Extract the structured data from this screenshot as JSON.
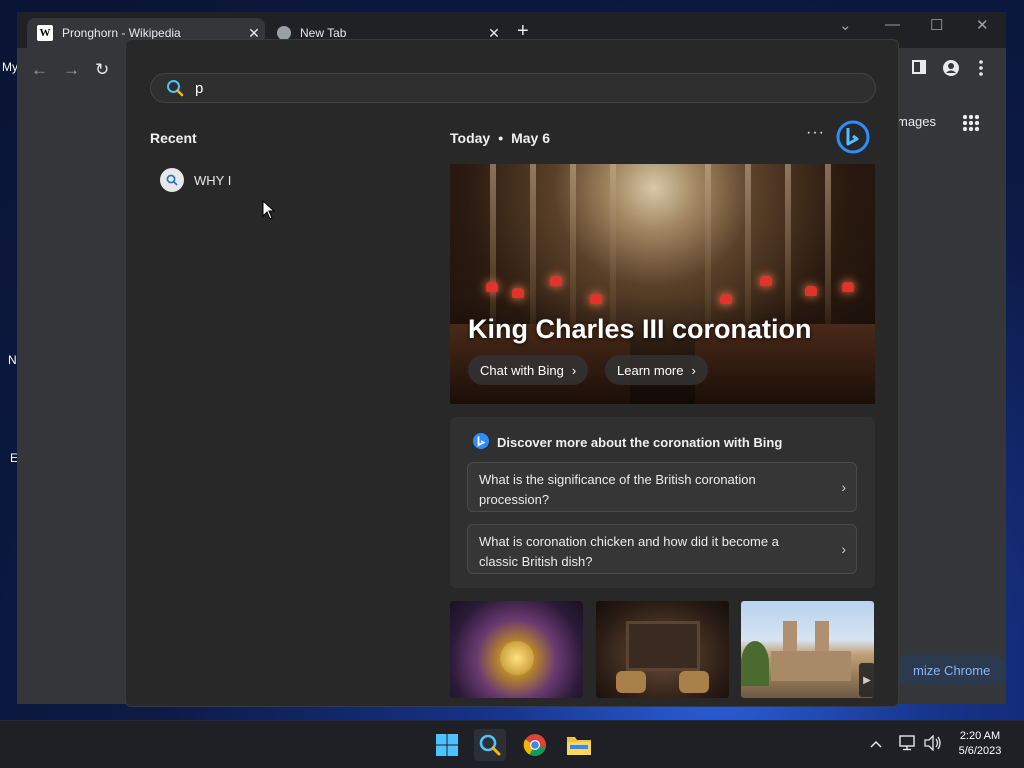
{
  "desktop": {
    "icon_labels": [
      "My",
      "N",
      "E"
    ]
  },
  "browser": {
    "tabs": [
      {
        "title": "Pronghorn - Wikipedia",
        "favicon": "W"
      },
      {
        "title": "New Tab",
        "favicon": ""
      }
    ],
    "new_tab_symbol": "+",
    "close_symbol": "✕",
    "window_controls": {
      "dropdown": "⌄",
      "minimize": "—",
      "maximize": "☐",
      "close": "✕"
    },
    "nav": {
      "back": "←",
      "forward": "→",
      "reload": "↻"
    },
    "ntp": {
      "images_link": "mages",
      "customize_button": "mize Chrome"
    }
  },
  "search": {
    "query": "p",
    "recent_title": "Recent",
    "recent_items": [
      {
        "label": "WHY I"
      }
    ],
    "today_label": "Today",
    "date_label": "May 6",
    "more_symbol": "···",
    "hero": {
      "title": "King Charles III coronation",
      "buttons": [
        {
          "label": "Chat with Bing"
        },
        {
          "label": "Learn more"
        }
      ]
    },
    "discover": {
      "title": "Discover more about the coronation with Bing",
      "prompts": [
        {
          "text": "What is the significance of the British coronation procession?"
        },
        {
          "text": "What is coronation chicken and how did it become a classic British dish?"
        }
      ]
    }
  },
  "taskbar": {
    "time": "2:20 AM",
    "date": "5/6/2023",
    "tray_up_arrow": "^"
  },
  "colors": {
    "accent_blue": "#2d8cff",
    "flyout_bg": "#282828",
    "chrome_bg": "#35363a"
  }
}
